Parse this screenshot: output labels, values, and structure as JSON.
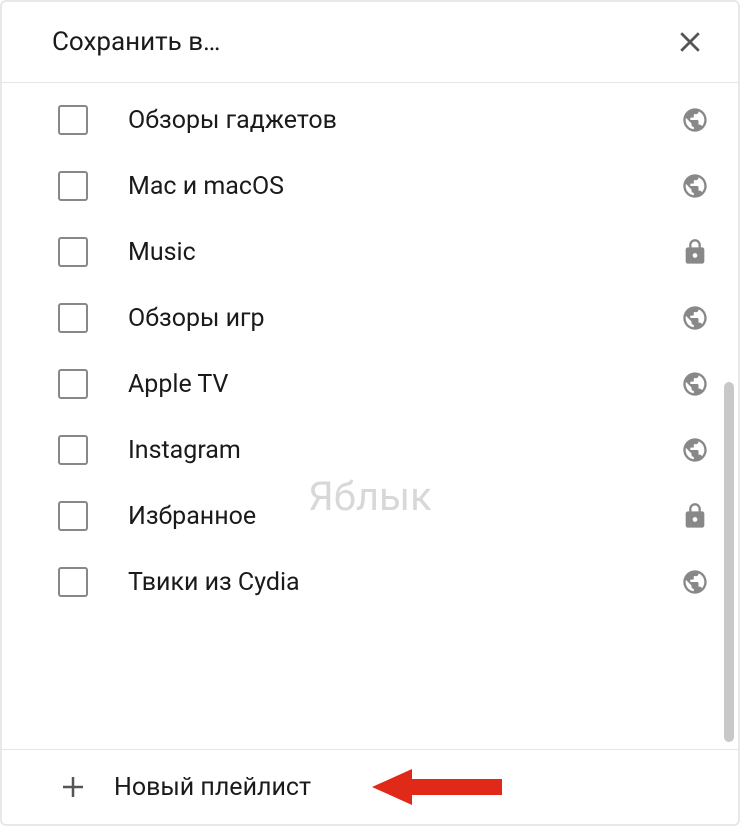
{
  "header": {
    "title": "Сохранить в…"
  },
  "playlists": [
    {
      "label": "Обзоры гаджетов",
      "visibility": "public"
    },
    {
      "label": "Mac и macOS",
      "visibility": "public"
    },
    {
      "label": "Music",
      "visibility": "private"
    },
    {
      "label": "Обзоры игр",
      "visibility": "public"
    },
    {
      "label": "Apple TV",
      "visibility": "public"
    },
    {
      "label": "Instagram",
      "visibility": "public"
    },
    {
      "label": "Избранное",
      "visibility": "private"
    },
    {
      "label": "Твики из Cydia",
      "visibility": "public"
    }
  ],
  "footer": {
    "label": "Новый плейлист"
  },
  "watermark": "Яблык"
}
